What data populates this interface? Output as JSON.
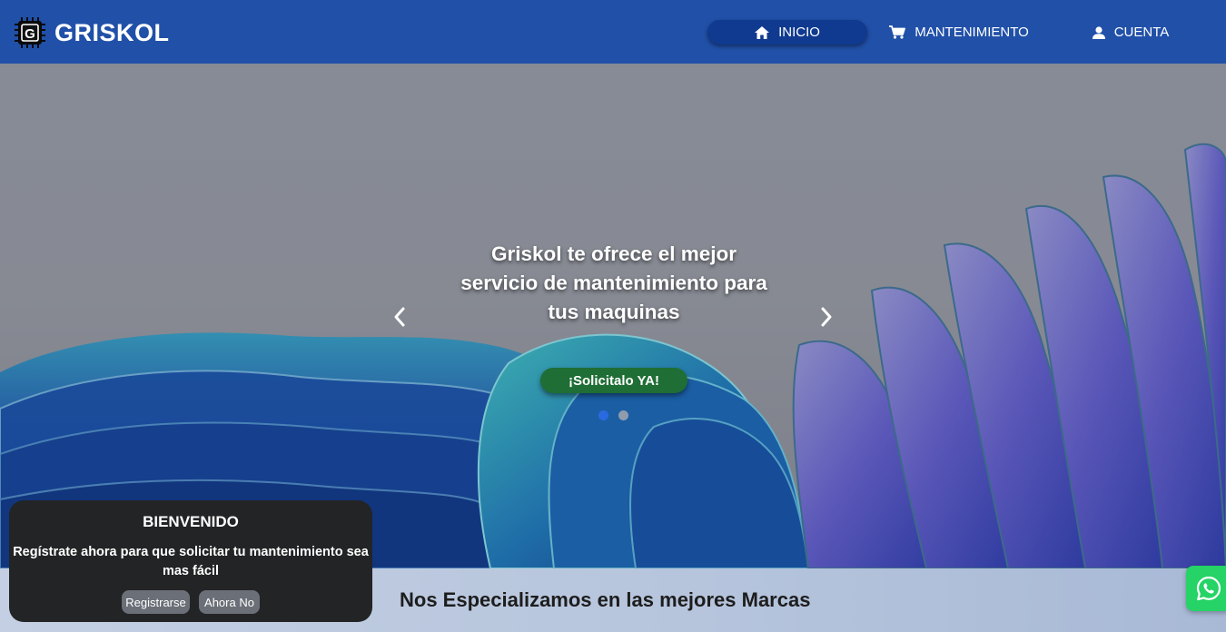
{
  "brand": {
    "logo_letter": "G",
    "name": "GRISKOL"
  },
  "nav": {
    "items": [
      {
        "label": "INICIO",
        "icon": "home-icon",
        "active": true
      },
      {
        "label": "MANTENIMIENTO",
        "icon": "cart-icon",
        "active": false
      },
      {
        "label": "CUENTA",
        "icon": "user-icon",
        "active": false
      }
    ]
  },
  "hero": {
    "title": "Griskol te ofrece el mejor servicio de mantenimiento para tus maquinas",
    "cta_label": "¡Solicitalo YA!",
    "prev_icon": "chevron-left-icon",
    "next_icon": "chevron-right-icon",
    "slides": 2,
    "active_slide": 1
  },
  "brands": {
    "title": "Nos Especializamos en las mejores Marcas"
  },
  "welcome": {
    "title": "BIENVENIDO",
    "text": "Regístrate ahora para que solicitar tu mantenimiento sea mas fácil",
    "register_label": "Registrarse",
    "dismiss_label": "Ahora No"
  },
  "whatsapp": {
    "icon": "whatsapp-icon"
  },
  "colors": {
    "navbar": "#2150a8",
    "nav_active": "#0f3a8f",
    "cta": "#1f6e35",
    "popup": "#232425",
    "whatsapp": "#25d366"
  }
}
